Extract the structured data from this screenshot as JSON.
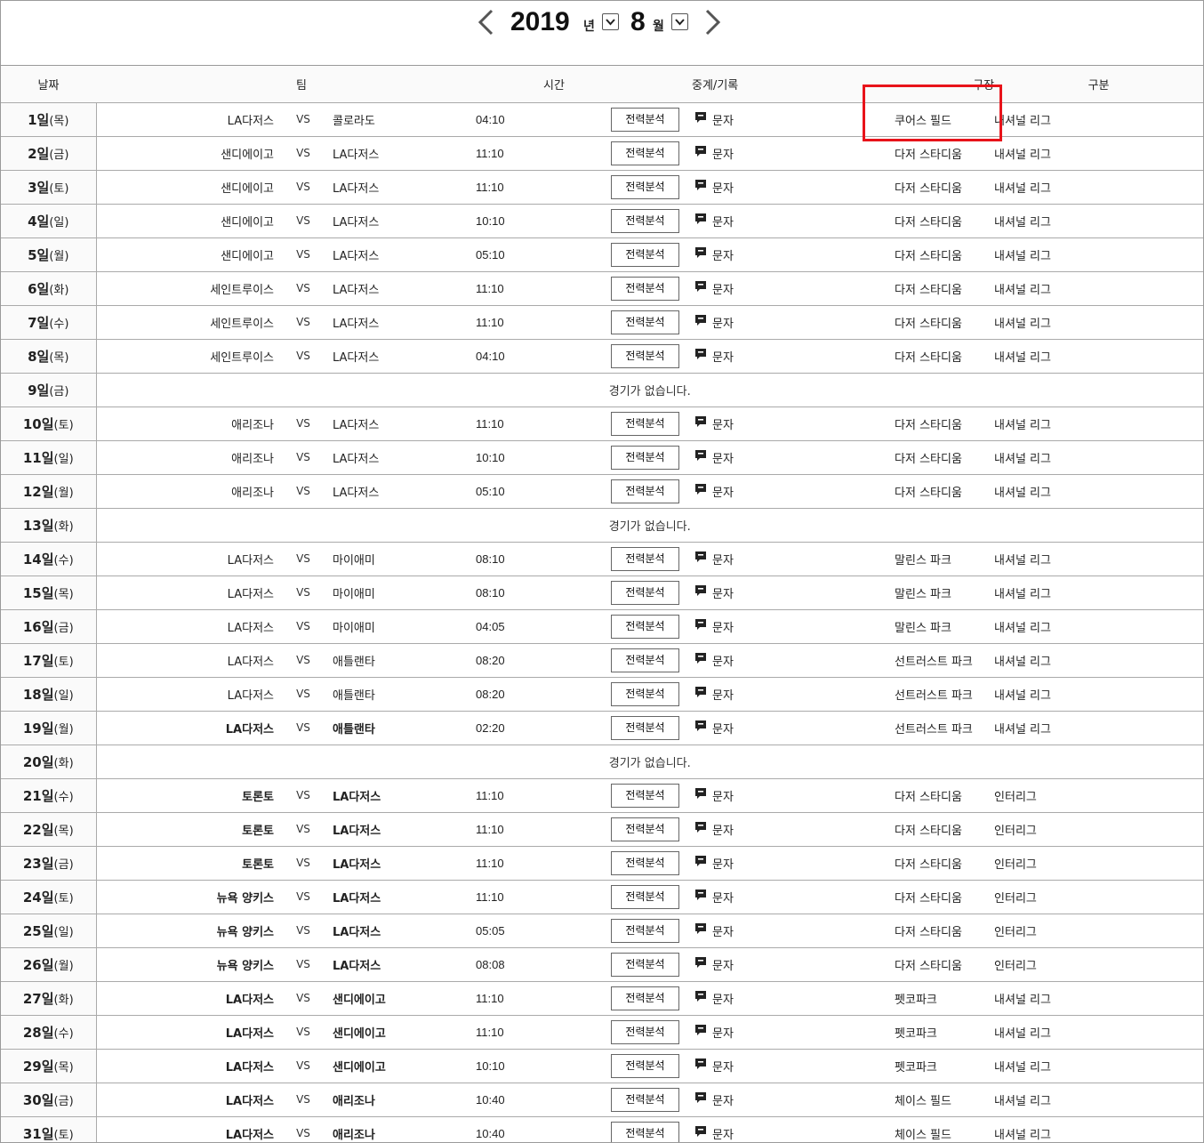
{
  "header": {
    "year": "2019",
    "year_unit": "년",
    "month": "8",
    "month_unit": "월"
  },
  "columns": {
    "date": "날짜",
    "team": "팀",
    "time": "시간",
    "broadcast": "중계/기록",
    "stadium": "구장",
    "league": "구분"
  },
  "analysis_label": "전력분석",
  "broadcast_label": "문자",
  "vs_label": "VS",
  "no_game_text": "경기가 없습니다.",
  "highlight_color": "#e8131a",
  "rows": [
    {
      "day": "1일",
      "dow": "(목)",
      "home": "LA다저스",
      "away": "콜로라도",
      "time": "04:10",
      "stadium": "쿠어스 필드",
      "league": "내셔널 리그",
      "nogame": false,
      "bold": false
    },
    {
      "day": "2일",
      "dow": "(금)",
      "home": "샌디에이고",
      "away": "LA다저스",
      "time": "11:10",
      "stadium": "다저 스타디움",
      "league": "내셔널 리그",
      "nogame": false,
      "bold": false
    },
    {
      "day": "3일",
      "dow": "(토)",
      "home": "샌디에이고",
      "away": "LA다저스",
      "time": "11:10",
      "stadium": "다저 스타디움",
      "league": "내셔널 리그",
      "nogame": false,
      "bold": false
    },
    {
      "day": "4일",
      "dow": "(일)",
      "home": "샌디에이고",
      "away": "LA다저스",
      "time": "10:10",
      "stadium": "다저 스타디움",
      "league": "내셔널 리그",
      "nogame": false,
      "bold": false
    },
    {
      "day": "5일",
      "dow": "(월)",
      "home": "샌디에이고",
      "away": "LA다저스",
      "time": "05:10",
      "stadium": "다저 스타디움",
      "league": "내셔널 리그",
      "nogame": false,
      "bold": false
    },
    {
      "day": "6일",
      "dow": "(화)",
      "home": "세인트루이스",
      "away": "LA다저스",
      "time": "11:10",
      "stadium": "다저 스타디움",
      "league": "내셔널 리그",
      "nogame": false,
      "bold": false
    },
    {
      "day": "7일",
      "dow": "(수)",
      "home": "세인트루이스",
      "away": "LA다저스",
      "time": "11:10",
      "stadium": "다저 스타디움",
      "league": "내셔널 리그",
      "nogame": false,
      "bold": false
    },
    {
      "day": "8일",
      "dow": "(목)",
      "home": "세인트루이스",
      "away": "LA다저스",
      "time": "04:10",
      "stadium": "다저 스타디움",
      "league": "내셔널 리그",
      "nogame": false,
      "bold": false
    },
    {
      "day": "9일",
      "dow": "(금)",
      "nogame": true
    },
    {
      "day": "10일",
      "dow": "(토)",
      "home": "애리조나",
      "away": "LA다저스",
      "time": "11:10",
      "stadium": "다저 스타디움",
      "league": "내셔널 리그",
      "nogame": false,
      "bold": false
    },
    {
      "day": "11일",
      "dow": "(일)",
      "home": "애리조나",
      "away": "LA다저스",
      "time": "10:10",
      "stadium": "다저 스타디움",
      "league": "내셔널 리그",
      "nogame": false,
      "bold": false
    },
    {
      "day": "12일",
      "dow": "(월)",
      "home": "애리조나",
      "away": "LA다저스",
      "time": "05:10",
      "stadium": "다저 스타디움",
      "league": "내셔널 리그",
      "nogame": false,
      "bold": false
    },
    {
      "day": "13일",
      "dow": "(화)",
      "nogame": true
    },
    {
      "day": "14일",
      "dow": "(수)",
      "home": "LA다저스",
      "away": "마이애미",
      "time": "08:10",
      "stadium": "말린스 파크",
      "league": "내셔널 리그",
      "nogame": false,
      "bold": false
    },
    {
      "day": "15일",
      "dow": "(목)",
      "home": "LA다저스",
      "away": "마이애미",
      "time": "08:10",
      "stadium": "말린스 파크",
      "league": "내셔널 리그",
      "nogame": false,
      "bold": false
    },
    {
      "day": "16일",
      "dow": "(금)",
      "home": "LA다저스",
      "away": "마이애미",
      "time": "04:05",
      "stadium": "말린스 파크",
      "league": "내셔널 리그",
      "nogame": false,
      "bold": false
    },
    {
      "day": "17일",
      "dow": "(토)",
      "home": "LA다저스",
      "away": "애틀랜타",
      "time": "08:20",
      "stadium": "선트러스트 파크",
      "league": "내셔널 리그",
      "nogame": false,
      "bold": false
    },
    {
      "day": "18일",
      "dow": "(일)",
      "home": "LA다저스",
      "away": "애틀랜타",
      "time": "08:20",
      "stadium": "선트러스트 파크",
      "league": "내셔널 리그",
      "nogame": false,
      "bold": false
    },
    {
      "day": "19일",
      "dow": "(월)",
      "home": "LA다저스",
      "away": "애틀랜타",
      "time": "02:20",
      "stadium": "선트러스트 파크",
      "league": "내셔널 리그",
      "nogame": false,
      "bold": true
    },
    {
      "day": "20일",
      "dow": "(화)",
      "nogame": true
    },
    {
      "day": "21일",
      "dow": "(수)",
      "home": "토론토",
      "away": "LA다저스",
      "time": "11:10",
      "stadium": "다저 스타디움",
      "league": "인터리그",
      "nogame": false,
      "bold": true
    },
    {
      "day": "22일",
      "dow": "(목)",
      "home": "토론토",
      "away": "LA다저스",
      "time": "11:10",
      "stadium": "다저 스타디움",
      "league": "인터리그",
      "nogame": false,
      "bold": true
    },
    {
      "day": "23일",
      "dow": "(금)",
      "home": "토론토",
      "away": "LA다저스",
      "time": "11:10",
      "stadium": "다저 스타디움",
      "league": "인터리그",
      "nogame": false,
      "bold": true
    },
    {
      "day": "24일",
      "dow": "(토)",
      "home": "뉴욕 양키스",
      "away": "LA다저스",
      "time": "11:10",
      "stadium": "다저 스타디움",
      "league": "인터리그",
      "nogame": false,
      "bold": true
    },
    {
      "day": "25일",
      "dow": "(일)",
      "home": "뉴욕 양키스",
      "away": "LA다저스",
      "time": "05:05",
      "stadium": "다저 스타디움",
      "league": "인터리그",
      "nogame": false,
      "bold": true
    },
    {
      "day": "26일",
      "dow": "(월)",
      "home": "뉴욕 양키스",
      "away": "LA다저스",
      "time": "08:08",
      "stadium": "다저 스타디움",
      "league": "인터리그",
      "nogame": false,
      "bold": true
    },
    {
      "day": "27일",
      "dow": "(화)",
      "home": "LA다저스",
      "away": "샌디에이고",
      "time": "11:10",
      "stadium": "펫코파크",
      "league": "내셔널 리그",
      "nogame": false,
      "bold": true
    },
    {
      "day": "28일",
      "dow": "(수)",
      "home": "LA다저스",
      "away": "샌디에이고",
      "time": "11:10",
      "stadium": "펫코파크",
      "league": "내셔널 리그",
      "nogame": false,
      "bold": true
    },
    {
      "day": "29일",
      "dow": "(목)",
      "home": "LA다저스",
      "away": "샌디에이고",
      "time": "10:10",
      "stadium": "펫코파크",
      "league": "내셔널 리그",
      "nogame": false,
      "bold": true
    },
    {
      "day": "30일",
      "dow": "(금)",
      "home": "LA다저스",
      "away": "애리조나",
      "time": "10:40",
      "stadium": "체이스 필드",
      "league": "내셔널 리그",
      "nogame": false,
      "bold": true
    },
    {
      "day": "31일",
      "dow": "(토)",
      "home": "LA다저스",
      "away": "애리조나",
      "time": "10:40",
      "stadium": "체이스 필드",
      "league": "내셔널 리그",
      "nogame": false,
      "bold": true
    }
  ]
}
